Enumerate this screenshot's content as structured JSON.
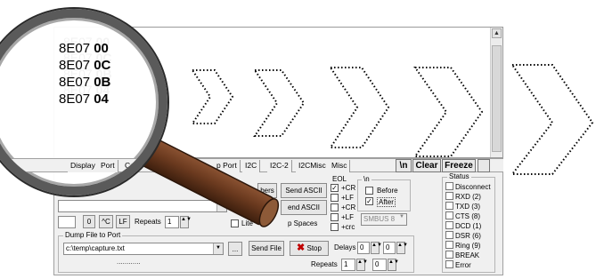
{
  "terminal": {
    "lines": [
      {
        "addr": "8E07",
        "val": "00"
      },
      {
        "addr": "8E07",
        "val": "0C"
      },
      {
        "addr": "8E07",
        "val": "0B"
      },
      {
        "addr": "8E07",
        "val": "04"
      }
    ]
  },
  "tabs": [
    "Display",
    "Port",
    "Capt",
    "p Port",
    "I2C",
    "I2C-2",
    "I2CMisc",
    "Misc"
  ],
  "tab_buttons": {
    "newline": "\\n",
    "clear": "Clear",
    "freeze": "Freeze"
  },
  "send": {
    "numbers_btn": "bers",
    "send_ascii_1": "Send ASCII",
    "send_ascii_2": "end ASCII",
    "field_value": "0",
    "cr_btn": "^C",
    "lf_btn": "LF",
    "repeats_label": "Repeats",
    "repeats_value": "1",
    "literal_label": "Lite",
    "strip_spaces_label": "p Spaces"
  },
  "eol": {
    "title": "EOL",
    "options": [
      {
        "label": "+CR",
        "checked": true
      },
      {
        "label": "+LF",
        "checked": false
      },
      {
        "label": "+CR",
        "checked": false
      },
      {
        "label": "+LF",
        "checked": false
      },
      {
        "label": "+crc",
        "checked": false
      }
    ],
    "smbus": "SMBUS 8"
  },
  "newline_group": {
    "title": "\\n",
    "before": "Before",
    "after": "After",
    "after_checked": true
  },
  "dump": {
    "title": "Dump File to Port",
    "path": "c:\\temp\\capture.txt",
    "browse": "...",
    "send_file": "Send File",
    "stop": "Stop",
    "delays_label": "Delays",
    "delay1": "0",
    "delay2": "0",
    "repeats_label": "Repeats",
    "repeats1": "1",
    "repeats2": "0",
    "progress": "............"
  },
  "status": {
    "title": "Status",
    "items": [
      "Disconnect",
      "RXD (2)",
      "TXD (3)",
      "CTS (8)",
      "DCD (1)",
      "DSR (6)",
      "Ring (9)",
      "BREAK",
      "Error"
    ]
  },
  "colors": {
    "magnifier_handle": "#6b3a1f",
    "arrow_dots": "#000000"
  }
}
